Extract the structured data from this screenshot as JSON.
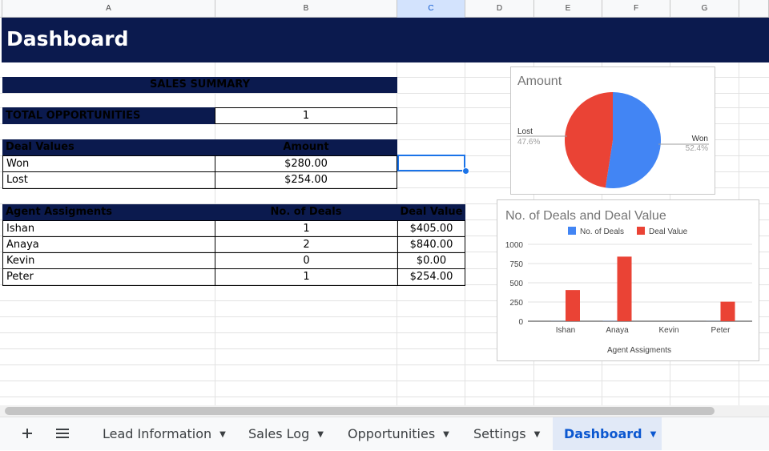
{
  "columns": [
    "A",
    "B",
    "C",
    "D",
    "E",
    "F",
    "G"
  ],
  "title": "Dashboard",
  "sales_summary": {
    "header": "SALES SUMMARY",
    "total_label": "TOTAL OPPORTUNITIES",
    "total_value": "1"
  },
  "deal_values": {
    "header_label": "Deal Values",
    "header_amount": "Amount",
    "rows": [
      {
        "label": "Won",
        "amount": "$280.00"
      },
      {
        "label": "Lost",
        "amount": "$254.00"
      }
    ]
  },
  "agents": {
    "headers": [
      "Agent Assigments",
      "No. of Deals",
      "Deal Value"
    ],
    "rows": [
      {
        "name": "Ishan",
        "deals": "1",
        "value": "$405.00"
      },
      {
        "name": "Anaya",
        "deals": "2",
        "value": "$840.00"
      },
      {
        "name": "Kevin",
        "deals": "0",
        "value": "$0.00"
      },
      {
        "name": "Peter",
        "deals": "1",
        "value": "$254.00"
      }
    ]
  },
  "chart_data": [
    {
      "type": "pie",
      "title": "Amount",
      "labels": [
        "Won",
        "Lost"
      ],
      "values": [
        280,
        254
      ],
      "percent_labels": [
        "52.4%",
        "47.6%"
      ],
      "colors": [
        "#4285f4",
        "#ea4335"
      ]
    },
    {
      "type": "bar",
      "title": "No. of Deals and Deal Value",
      "categories": [
        "Ishan",
        "Anaya",
        "Kevin",
        "Peter"
      ],
      "series": [
        {
          "name": "No. of Deals",
          "values": [
            1,
            2,
            0,
            1
          ],
          "color": "#4285f4"
        },
        {
          "name": "Deal Value",
          "values": [
            405,
            840,
            0,
            254
          ],
          "color": "#ea4335"
        }
      ],
      "xlabel": "Agent Assigments",
      "ylabel": "",
      "yticks": [
        "0",
        "250",
        "500",
        "750",
        "1000"
      ],
      "ylim": [
        0,
        1000
      ],
      "legend": "top"
    }
  ],
  "tabs": {
    "add_icon": "plus-icon",
    "menu_icon": "menu-icon",
    "items": [
      "Lead Information",
      "Sales Log",
      "Opportunities",
      "Settings",
      "Dashboard"
    ],
    "active": "Dashboard"
  }
}
